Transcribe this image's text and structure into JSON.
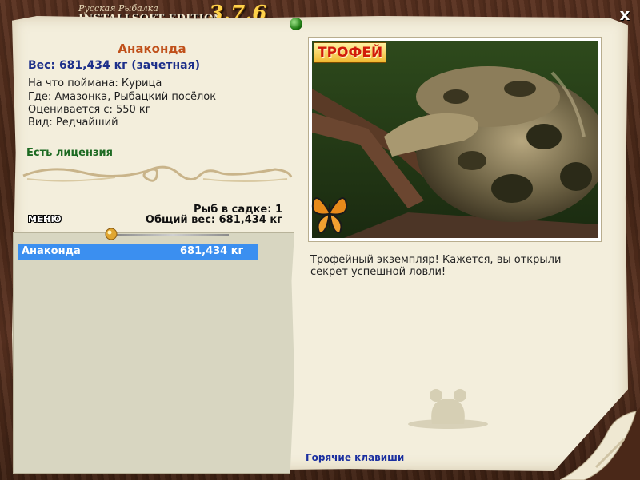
{
  "app": {
    "logo_line1": "Русская Рыбалка",
    "logo_line2": "INSTALLSOFT EDITION",
    "version": "3.7.6",
    "close_label": "x"
  },
  "fish": {
    "name": "Анаконда",
    "weight_line": "Вес: 681,434 кг (зачетная)",
    "bait_line": "На что поймана: Курица",
    "place_line": "Где: Амазонка, Рыбацкий посёлок",
    "value_line": "Оценивается с: 550 кг",
    "kind_line": "Вид: Редчайший",
    "license": "Есть лицензия"
  },
  "keepnet": {
    "count_line": "Рыб в садке: 1",
    "total_line": "Общий вес: 681,434 кг",
    "menu_label": "МЕНЮ",
    "items": [
      {
        "name": "Анаконда",
        "weight": "681,434 кг",
        "selected": true
      }
    ]
  },
  "trophy": {
    "badge": "ТРОФЕЙ",
    "description": "Трофейный экземпляр! Кажется, вы открыли секрет успешной ловли!"
  },
  "footer": {
    "hotkeys_link": "Горячие клавиши"
  },
  "colors": {
    "fish_name": "#c0501a",
    "weight": "#1c2f8a",
    "license": "#1d6a22",
    "selected_row": "#3b8ff0",
    "version": "#ffd24a",
    "link": "#1a2fa0"
  },
  "icons": [
    "close-icon",
    "pin-icon",
    "butterfly-icon",
    "snake-photo",
    "mouse-silhouette-icon",
    "page-curl-ornament"
  ]
}
